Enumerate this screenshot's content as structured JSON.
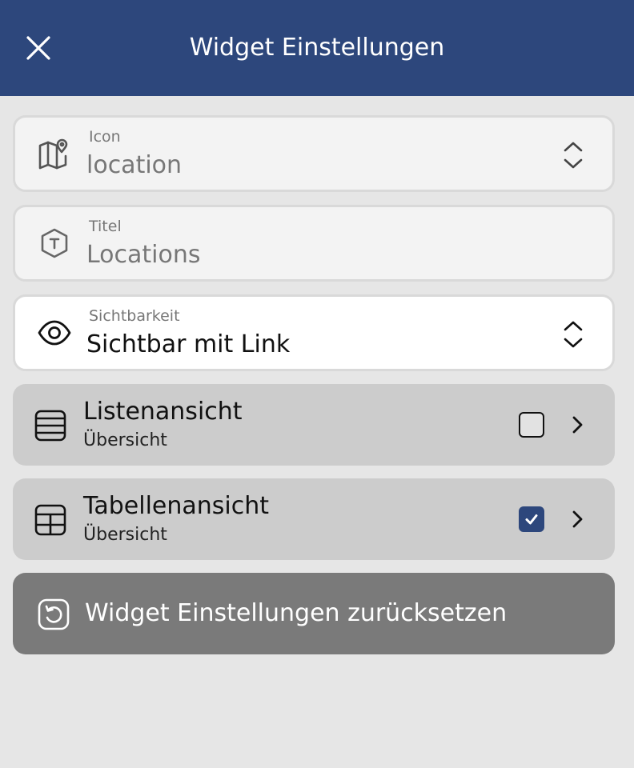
{
  "header": {
    "title": "Widget Einstellungen",
    "close_icon": "close-icon",
    "background": "#2d477c"
  },
  "fields": {
    "icon": {
      "label": "Icon",
      "value": "location",
      "icon": "map-pin-icon"
    },
    "title": {
      "label": "Titel",
      "value": "Locations",
      "icon": "title-hexagon-icon"
    },
    "visibility": {
      "label": "Sichtbarkeit",
      "value": "Sichtbar mit Link",
      "icon": "eye-icon"
    }
  },
  "views": [
    {
      "title": "Listenansicht",
      "subtitle": "Übersicht",
      "icon": "list-view-icon",
      "checked": false
    },
    {
      "title": "Tabellenansicht",
      "subtitle": "Übersicht",
      "icon": "table-view-icon",
      "checked": true
    }
  ],
  "reset": {
    "label": "Widget Einstellungen zurücksetzen",
    "icon": "reset-icon"
  },
  "colors": {
    "accent": "#2d477c",
    "card": "#cccccc",
    "reset_button": "#7a7a7a",
    "background": "#e6e6e6"
  }
}
